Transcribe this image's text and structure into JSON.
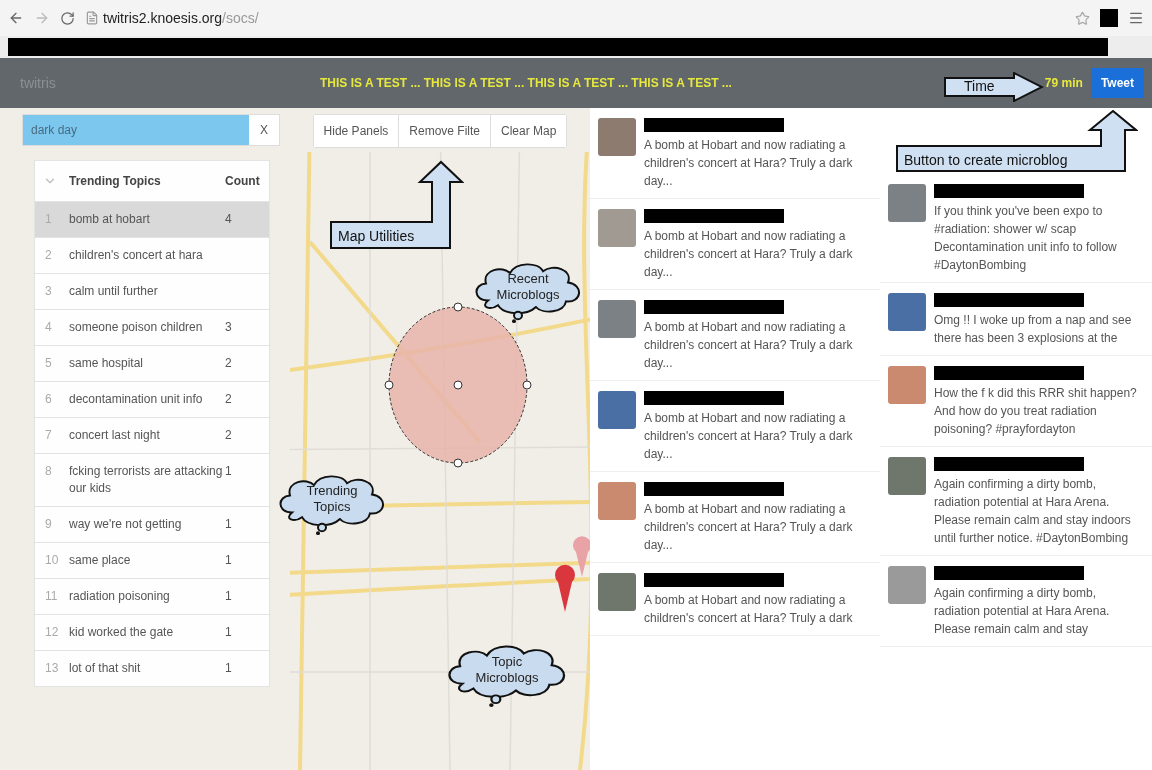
{
  "browser": {
    "url_host": "twitris2.knoesis.org",
    "url_path": "/socs/"
  },
  "header": {
    "logo": "twitris",
    "ticker": "THIS IS A TEST ... THIS IS A TEST ... THIS IS A TEST ... THIS IS A TEST ...",
    "time": "79 min",
    "tweet_button": "Tweet"
  },
  "search": {
    "value": "dark day",
    "clear_button": "X"
  },
  "trending": {
    "columns": [
      "Trending Topics",
      "Count"
    ],
    "rows": [
      {
        "rank": "1",
        "topic": "bomb at hobart",
        "count": "4",
        "selected": true
      },
      {
        "rank": "2",
        "topic": "children's concert at hara",
        "selected": false
      },
      {
        "rank": "3",
        "topic": "calm until further",
        "selected": false
      },
      {
        "rank": "4",
        "topic": "someone poison children",
        "count": "3",
        "selected": false
      },
      {
        "rank": "5",
        "topic": "same hospital",
        "count": "2",
        "selected": false
      },
      {
        "rank": "6",
        "topic": "decontamination unit info",
        "count": "2",
        "selected": false
      },
      {
        "rank": "7",
        "topic": "concert last night",
        "count": "2",
        "selected": false
      },
      {
        "rank": "8",
        "topic": "fcking terrorists are attacking our kids",
        "count": "1",
        "selected": false
      },
      {
        "rank": "9",
        "topic": "way we're not getting",
        "count": "1",
        "selected": false
      },
      {
        "rank": "10",
        "topic": "same place",
        "count": "1",
        "selected": false
      },
      {
        "rank": "11",
        "topic": "radiation poisoning",
        "count": "1",
        "selected": false
      },
      {
        "rank": "12",
        "topic": "kid worked the gate",
        "count": "1",
        "selected": false
      },
      {
        "rank": "13",
        "topic": "lot of that shit",
        "count": "1",
        "selected": false
      }
    ]
  },
  "map_buttons": [
    "Hide Panels",
    "Remove Filte",
    "Clear Map"
  ],
  "topic_microblogs": [
    {
      "text": "A bomb at Hobart and now radiating a children's concert at Hara? Truly a dark day..."
    },
    {
      "text": "A bomb at Hobart and now radiating a children's concert at Hara? Truly a dark day..."
    },
    {
      "text": "A bomb at Hobart and now radiating a children's concert at Hara? Truly a dark day..."
    },
    {
      "text": "A bomb at Hobart and now radiating a children's concert at Hara? Truly a dark day..."
    },
    {
      "text": "A bomb at Hobart and now radiating a children's concert at Hara? Truly a dark day..."
    },
    {
      "text": "A bomb at Hobart and now radiating a children's concert at Hara? Truly a dark"
    }
  ],
  "recent_microblogs": [
    {
      "text": "If you think you've been expo to #radiation: shower w/ scap Decontamination unit info to follow #DaytonBombing"
    },
    {
      "text": "Omg !! I woke up from a nap and see there has been 3 explosions at the"
    },
    {
      "text": "How the f k did this RRR shit happen? And how do you treat radiation poisoning? #prayfordayton"
    },
    {
      "text": "Again confirming a dirty bomb, radiation potential at Hara Arena. Please remain calm and stay indoors until further notice. #DaytonBombing"
    },
    {
      "text": "Again confirming a dirty bomb, radiation potential at Hara Arena. Please remain calm and stay"
    }
  ],
  "annotations": [
    {
      "kind": "arrow_right",
      "label": "Time"
    },
    {
      "kind": "arrow_up_right",
      "label": "Button to create microblog"
    },
    {
      "kind": "arrow_up",
      "label": "Map Utilities"
    },
    {
      "kind": "cloud",
      "label": "Recent Microblogs"
    },
    {
      "kind": "cloud",
      "label": "Trending Topics"
    },
    {
      "kind": "cloud",
      "label": "Topic Microblogs"
    }
  ]
}
